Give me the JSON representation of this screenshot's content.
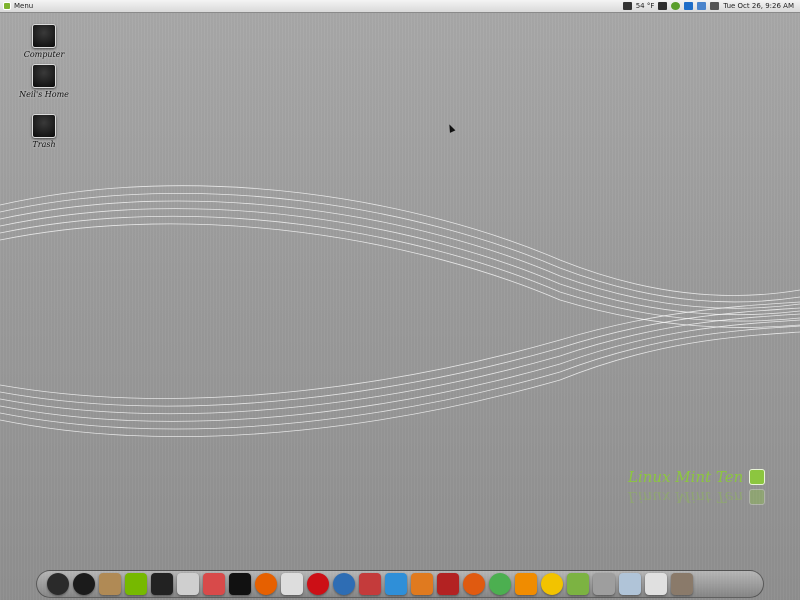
{
  "panel": {
    "menu_label": "Menu",
    "weather_temp": "54 °F",
    "clock": "Tue Oct 26,  9:26 AM"
  },
  "desktop_icons": [
    {
      "label": "Computer",
      "icon": "computer-icon"
    },
    {
      "label": "Neil's Home",
      "icon": "home-folder-icon"
    },
    {
      "label": "Trash",
      "icon": "trash-icon"
    }
  ],
  "branding": {
    "text": "Linux Mint Ten"
  },
  "dock_items": [
    {
      "name": "speedometer-icon",
      "color": "#2a2a2a"
    },
    {
      "name": "power-icon",
      "color": "#1b1b1b"
    },
    {
      "name": "package-installer-icon",
      "color": "#b08a55"
    },
    {
      "name": "nvidia-icon",
      "color": "#76b900"
    },
    {
      "name": "terminal-icon",
      "color": "#222222"
    },
    {
      "name": "drive-icon",
      "color": "#cfcfcf"
    },
    {
      "name": "screenshot-icon",
      "color": "#d84a4a"
    },
    {
      "name": "monitor-icon",
      "color": "#111111"
    },
    {
      "name": "firefox-icon",
      "color": "#e66000"
    },
    {
      "name": "mail-icon",
      "color": "#dddddd"
    },
    {
      "name": "opera-icon",
      "color": "#cc0f16"
    },
    {
      "name": "thunderbird-icon",
      "color": "#2e6db4"
    },
    {
      "name": "update-manager-icon",
      "color": "#c43b3b"
    },
    {
      "name": "bird-icon",
      "color": "#2f8fd8"
    },
    {
      "name": "bird-orange-icon",
      "color": "#e07a1f"
    },
    {
      "name": "dictionary-icon",
      "color": "#b32222"
    },
    {
      "name": "burner-icon",
      "color": "#e05a10"
    },
    {
      "name": "play-icon",
      "color": "#4caf50"
    },
    {
      "name": "vlc-icon",
      "color": "#f08c00"
    },
    {
      "name": "media-player-icon",
      "color": "#f2c300"
    },
    {
      "name": "music-icon",
      "color": "#7cb342"
    },
    {
      "name": "calculator-icon",
      "color": "#9e9e9e"
    },
    {
      "name": "scanner-icon",
      "color": "#b0c4d8"
    },
    {
      "name": "camera-icon",
      "color": "#e0e0e0"
    },
    {
      "name": "gimp-icon",
      "color": "#8a7a6a"
    }
  ]
}
